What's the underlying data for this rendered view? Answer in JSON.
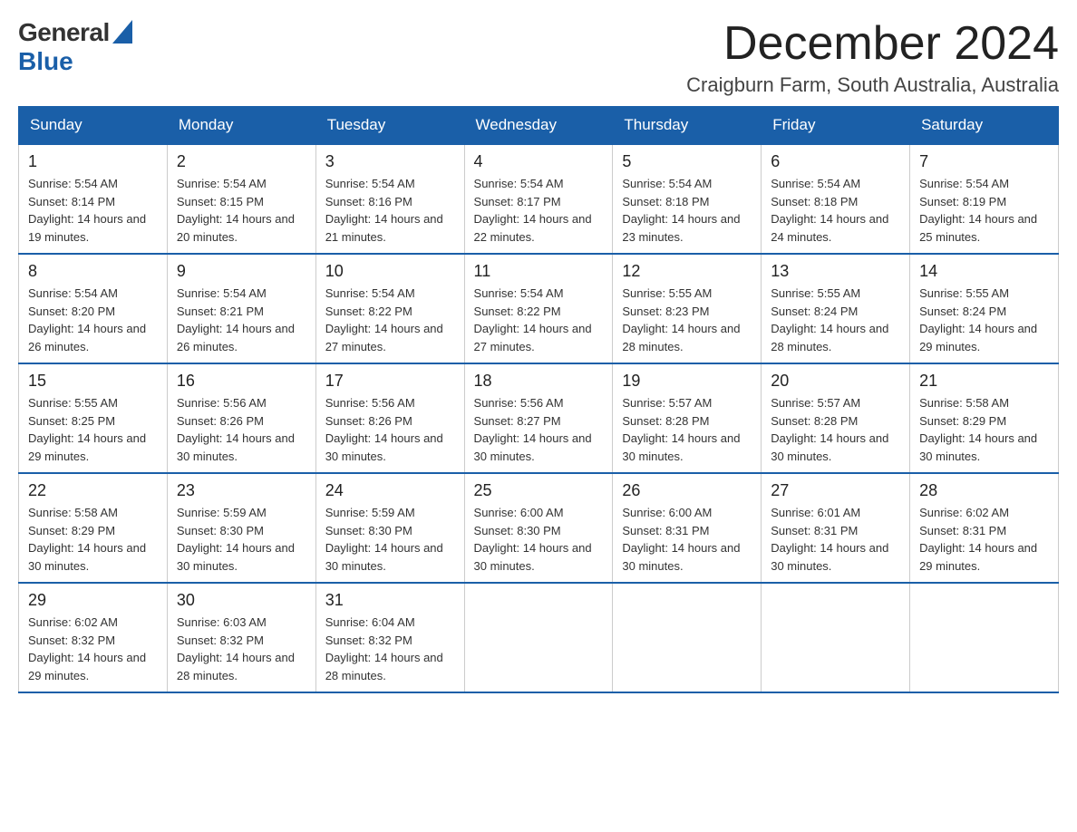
{
  "logo": {
    "general": "General",
    "blue": "Blue"
  },
  "header": {
    "title": "December 2024",
    "subtitle": "Craigburn Farm, South Australia, Australia"
  },
  "weekdays": [
    "Sunday",
    "Monday",
    "Tuesday",
    "Wednesday",
    "Thursday",
    "Friday",
    "Saturday"
  ],
  "weeks": [
    [
      {
        "day": "1",
        "sunrise": "5:54 AM",
        "sunset": "8:14 PM",
        "daylight": "14 hours and 19 minutes."
      },
      {
        "day": "2",
        "sunrise": "5:54 AM",
        "sunset": "8:15 PM",
        "daylight": "14 hours and 20 minutes."
      },
      {
        "day": "3",
        "sunrise": "5:54 AM",
        "sunset": "8:16 PM",
        "daylight": "14 hours and 21 minutes."
      },
      {
        "day": "4",
        "sunrise": "5:54 AM",
        "sunset": "8:17 PM",
        "daylight": "14 hours and 22 minutes."
      },
      {
        "day": "5",
        "sunrise": "5:54 AM",
        "sunset": "8:18 PM",
        "daylight": "14 hours and 23 minutes."
      },
      {
        "day": "6",
        "sunrise": "5:54 AM",
        "sunset": "8:18 PM",
        "daylight": "14 hours and 24 minutes."
      },
      {
        "day": "7",
        "sunrise": "5:54 AM",
        "sunset": "8:19 PM",
        "daylight": "14 hours and 25 minutes."
      }
    ],
    [
      {
        "day": "8",
        "sunrise": "5:54 AM",
        "sunset": "8:20 PM",
        "daylight": "14 hours and 26 minutes."
      },
      {
        "day": "9",
        "sunrise": "5:54 AM",
        "sunset": "8:21 PM",
        "daylight": "14 hours and 26 minutes."
      },
      {
        "day": "10",
        "sunrise": "5:54 AM",
        "sunset": "8:22 PM",
        "daylight": "14 hours and 27 minutes."
      },
      {
        "day": "11",
        "sunrise": "5:54 AM",
        "sunset": "8:22 PM",
        "daylight": "14 hours and 27 minutes."
      },
      {
        "day": "12",
        "sunrise": "5:55 AM",
        "sunset": "8:23 PM",
        "daylight": "14 hours and 28 minutes."
      },
      {
        "day": "13",
        "sunrise": "5:55 AM",
        "sunset": "8:24 PM",
        "daylight": "14 hours and 28 minutes."
      },
      {
        "day": "14",
        "sunrise": "5:55 AM",
        "sunset": "8:24 PM",
        "daylight": "14 hours and 29 minutes."
      }
    ],
    [
      {
        "day": "15",
        "sunrise": "5:55 AM",
        "sunset": "8:25 PM",
        "daylight": "14 hours and 29 minutes."
      },
      {
        "day": "16",
        "sunrise": "5:56 AM",
        "sunset": "8:26 PM",
        "daylight": "14 hours and 30 minutes."
      },
      {
        "day": "17",
        "sunrise": "5:56 AM",
        "sunset": "8:26 PM",
        "daylight": "14 hours and 30 minutes."
      },
      {
        "day": "18",
        "sunrise": "5:56 AM",
        "sunset": "8:27 PM",
        "daylight": "14 hours and 30 minutes."
      },
      {
        "day": "19",
        "sunrise": "5:57 AM",
        "sunset": "8:28 PM",
        "daylight": "14 hours and 30 minutes."
      },
      {
        "day": "20",
        "sunrise": "5:57 AM",
        "sunset": "8:28 PM",
        "daylight": "14 hours and 30 minutes."
      },
      {
        "day": "21",
        "sunrise": "5:58 AM",
        "sunset": "8:29 PM",
        "daylight": "14 hours and 30 minutes."
      }
    ],
    [
      {
        "day": "22",
        "sunrise": "5:58 AM",
        "sunset": "8:29 PM",
        "daylight": "14 hours and 30 minutes."
      },
      {
        "day": "23",
        "sunrise": "5:59 AM",
        "sunset": "8:30 PM",
        "daylight": "14 hours and 30 minutes."
      },
      {
        "day": "24",
        "sunrise": "5:59 AM",
        "sunset": "8:30 PM",
        "daylight": "14 hours and 30 minutes."
      },
      {
        "day": "25",
        "sunrise": "6:00 AM",
        "sunset": "8:30 PM",
        "daylight": "14 hours and 30 minutes."
      },
      {
        "day": "26",
        "sunrise": "6:00 AM",
        "sunset": "8:31 PM",
        "daylight": "14 hours and 30 minutes."
      },
      {
        "day": "27",
        "sunrise": "6:01 AM",
        "sunset": "8:31 PM",
        "daylight": "14 hours and 30 minutes."
      },
      {
        "day": "28",
        "sunrise": "6:02 AM",
        "sunset": "8:31 PM",
        "daylight": "14 hours and 29 minutes."
      }
    ],
    [
      {
        "day": "29",
        "sunrise": "6:02 AM",
        "sunset": "8:32 PM",
        "daylight": "14 hours and 29 minutes."
      },
      {
        "day": "30",
        "sunrise": "6:03 AM",
        "sunset": "8:32 PM",
        "daylight": "14 hours and 28 minutes."
      },
      {
        "day": "31",
        "sunrise": "6:04 AM",
        "sunset": "8:32 PM",
        "daylight": "14 hours and 28 minutes."
      },
      null,
      null,
      null,
      null
    ]
  ],
  "labels": {
    "sunrise": "Sunrise:",
    "sunset": "Sunset:",
    "daylight": "Daylight:"
  }
}
